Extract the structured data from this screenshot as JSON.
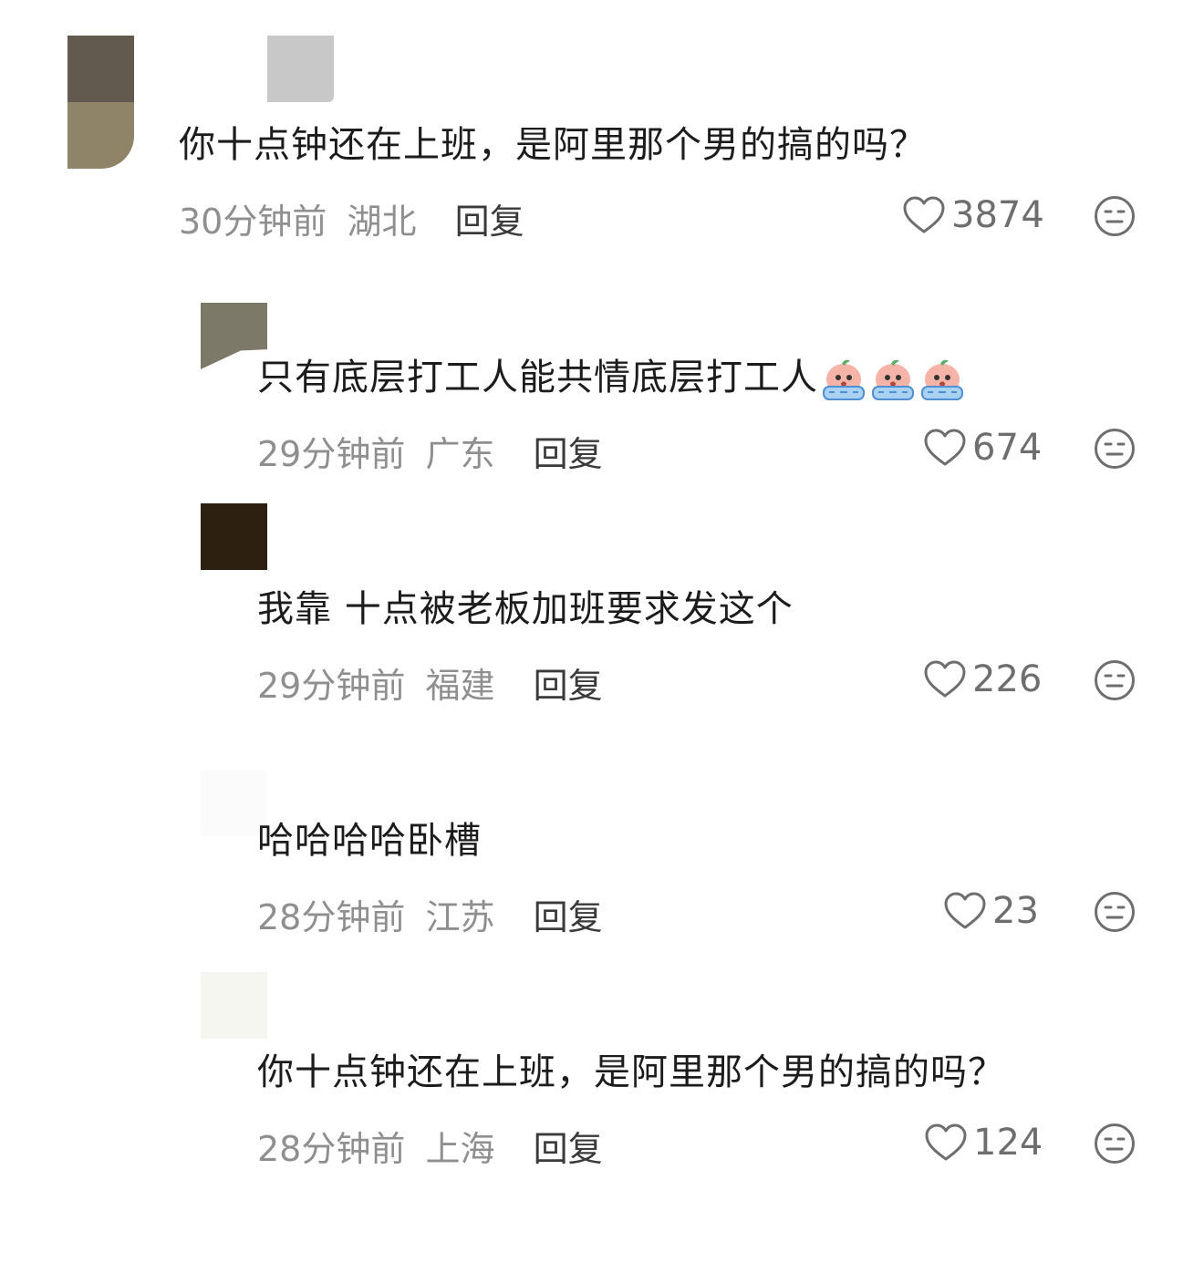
{
  "comments": [
    {
      "text": "你十点钟还在上班，是阿里那个男的搞的吗？",
      "time": "30分钟前",
      "location": "湖北",
      "reply_label": "回复",
      "likes": "3874"
    },
    {
      "text": "只有底层打工人能共情底层打工人",
      "emoji_icon": "crying-peach-emoji",
      "emoji_count": 3,
      "time": "29分钟前",
      "location": "广东",
      "reply_label": "回复",
      "likes": "674"
    },
    {
      "text": "我靠 十点被老板加班要求发这个",
      "time": "29分钟前",
      "location": "福建",
      "reply_label": "回复",
      "likes": "226"
    },
    {
      "text": "哈哈哈哈卧槽",
      "time": "28分钟前",
      "location": "江苏",
      "reply_label": "回复",
      "likes": "23"
    },
    {
      "text": "你十点钟还在上班，是阿里那个男的搞的吗？",
      "time": "28分钟前",
      "location": "上海",
      "reply_label": "回复",
      "likes": "124"
    }
  ],
  "colors": {
    "text": "#1c1c1c",
    "meta": "#8f8f8f",
    "reply": "#3a3a3a",
    "icon": "#6e6e6e"
  }
}
